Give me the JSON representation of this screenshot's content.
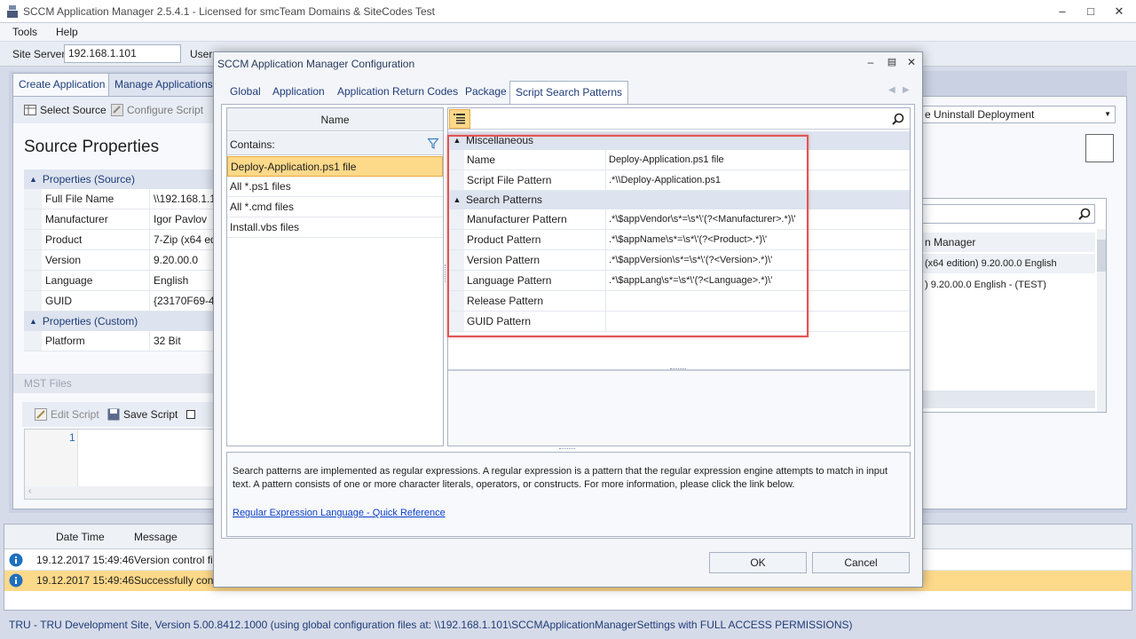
{
  "window": {
    "title": "SCCM Application Manager 2.5.4.1 - Licensed for smcTeam Domains & SiteCodes Test"
  },
  "menu": {
    "items": [
      "Tools",
      "Help"
    ]
  },
  "toolbar": {
    "site_server_label": "Site Server",
    "site_server_value": "192.168.1.101",
    "user_label": "User"
  },
  "main_tabs": [
    "Create Application",
    "Manage Applications"
  ],
  "source_toolbar": {
    "select_source": "Select Source",
    "configure_script": "Configure Script"
  },
  "source_panel": {
    "title": "Source Properties",
    "group_source": "Properties (Source)",
    "rows": [
      {
        "label": "Full File Name",
        "value": "\\\\192.168.1.10"
      },
      {
        "label": "Manufacturer",
        "value": "Igor Pavlov"
      },
      {
        "label": "Product",
        "value": "7-Zip (x64 edi"
      },
      {
        "label": "Version",
        "value": "9.20.00.0"
      },
      {
        "label": "Language",
        "value": "English"
      },
      {
        "label": "GUID",
        "value": "{23170F69-40"
      }
    ],
    "group_custom": "Properties (Custom)",
    "custom_rows": [
      {
        "label": "Platform",
        "value": "32 Bit"
      }
    ],
    "mst_files": "MST Files",
    "edit_script": "Edit Script",
    "save_script": "Save Script",
    "line_number": "1"
  },
  "right_panel": {
    "deployment_select": "e Uninstall Deployment",
    "col_header": "n Manager",
    "rows": [
      "(x64 edition) 9.20.00.0 English",
      ") 9.20.00.0 English - (TEST)"
    ]
  },
  "log": {
    "headers": [
      "Date Time",
      "Message"
    ],
    "rows": [
      {
        "time": "19.12.2017 15:49:46",
        "message": "Version control fil"
      },
      {
        "time": "19.12.2017 15:49:46",
        "message": "Successfully conne"
      }
    ]
  },
  "status_bar": "TRU - TRU Development Site, Version 5.00.8412.1000 (using global configuration files at: \\\\192.168.1.101\\SCCMApplicationManagerSettings with FULL ACCESS PERMISSIONS)",
  "dialog": {
    "title": "SCCM Application Manager Configuration",
    "tabs": [
      "Global",
      "Application",
      "Application Return Codes",
      "Package",
      "Script Search Patterns"
    ],
    "list_header": "Name",
    "filter_label": "Contains:",
    "list_items": [
      "Deploy-Application.ps1 file",
      "All *.ps1 files",
      "All *.cmd files",
      "Install.vbs files"
    ],
    "categories": {
      "misc": "Miscellaneous",
      "search": "Search Patterns"
    },
    "misc_rows": [
      {
        "name": "Name",
        "value": "Deploy-Application.ps1 file"
      },
      {
        "name": "Script File Pattern",
        "value": ".*\\\\Deploy-Application.ps1"
      }
    ],
    "search_rows": [
      {
        "name": "Manufacturer Pattern",
        "value": ".*\\$appVendor\\s*=\\s*\\'(?<Manufacturer>.*)\\'"
      },
      {
        "name": "Product Pattern",
        "value": ".*\\$appName\\s*=\\s*\\'(?<Product>.*)\\'"
      },
      {
        "name": "Version Pattern",
        "value": ".*\\$appVersion\\s*=\\s*\\'(?<Version>.*)\\'"
      },
      {
        "name": "Language Pattern",
        "value": ".*\\$appLang\\s*=\\s*\\'(?<Language>.*)\\'"
      },
      {
        "name": "Release Pattern",
        "value": ""
      },
      {
        "name": "GUID Pattern",
        "value": ""
      }
    ],
    "description": "Search patterns are implemented as regular expressions. A regular expression is a pattern that the regular expression engine attempts to match in input text. A pattern consists of one or more character literals, operators, or constructs. For more information, please click the link below.",
    "link": "Regular Expression Language - Quick Reference",
    "ok": "OK",
    "cancel": "Cancel"
  },
  "colors": {
    "selection": "#fdd98a",
    "selection_border": "#e8a73a",
    "highlight_box": "#e05555",
    "link": "#0b3ec8",
    "info_icon": "#1f6fbf"
  }
}
